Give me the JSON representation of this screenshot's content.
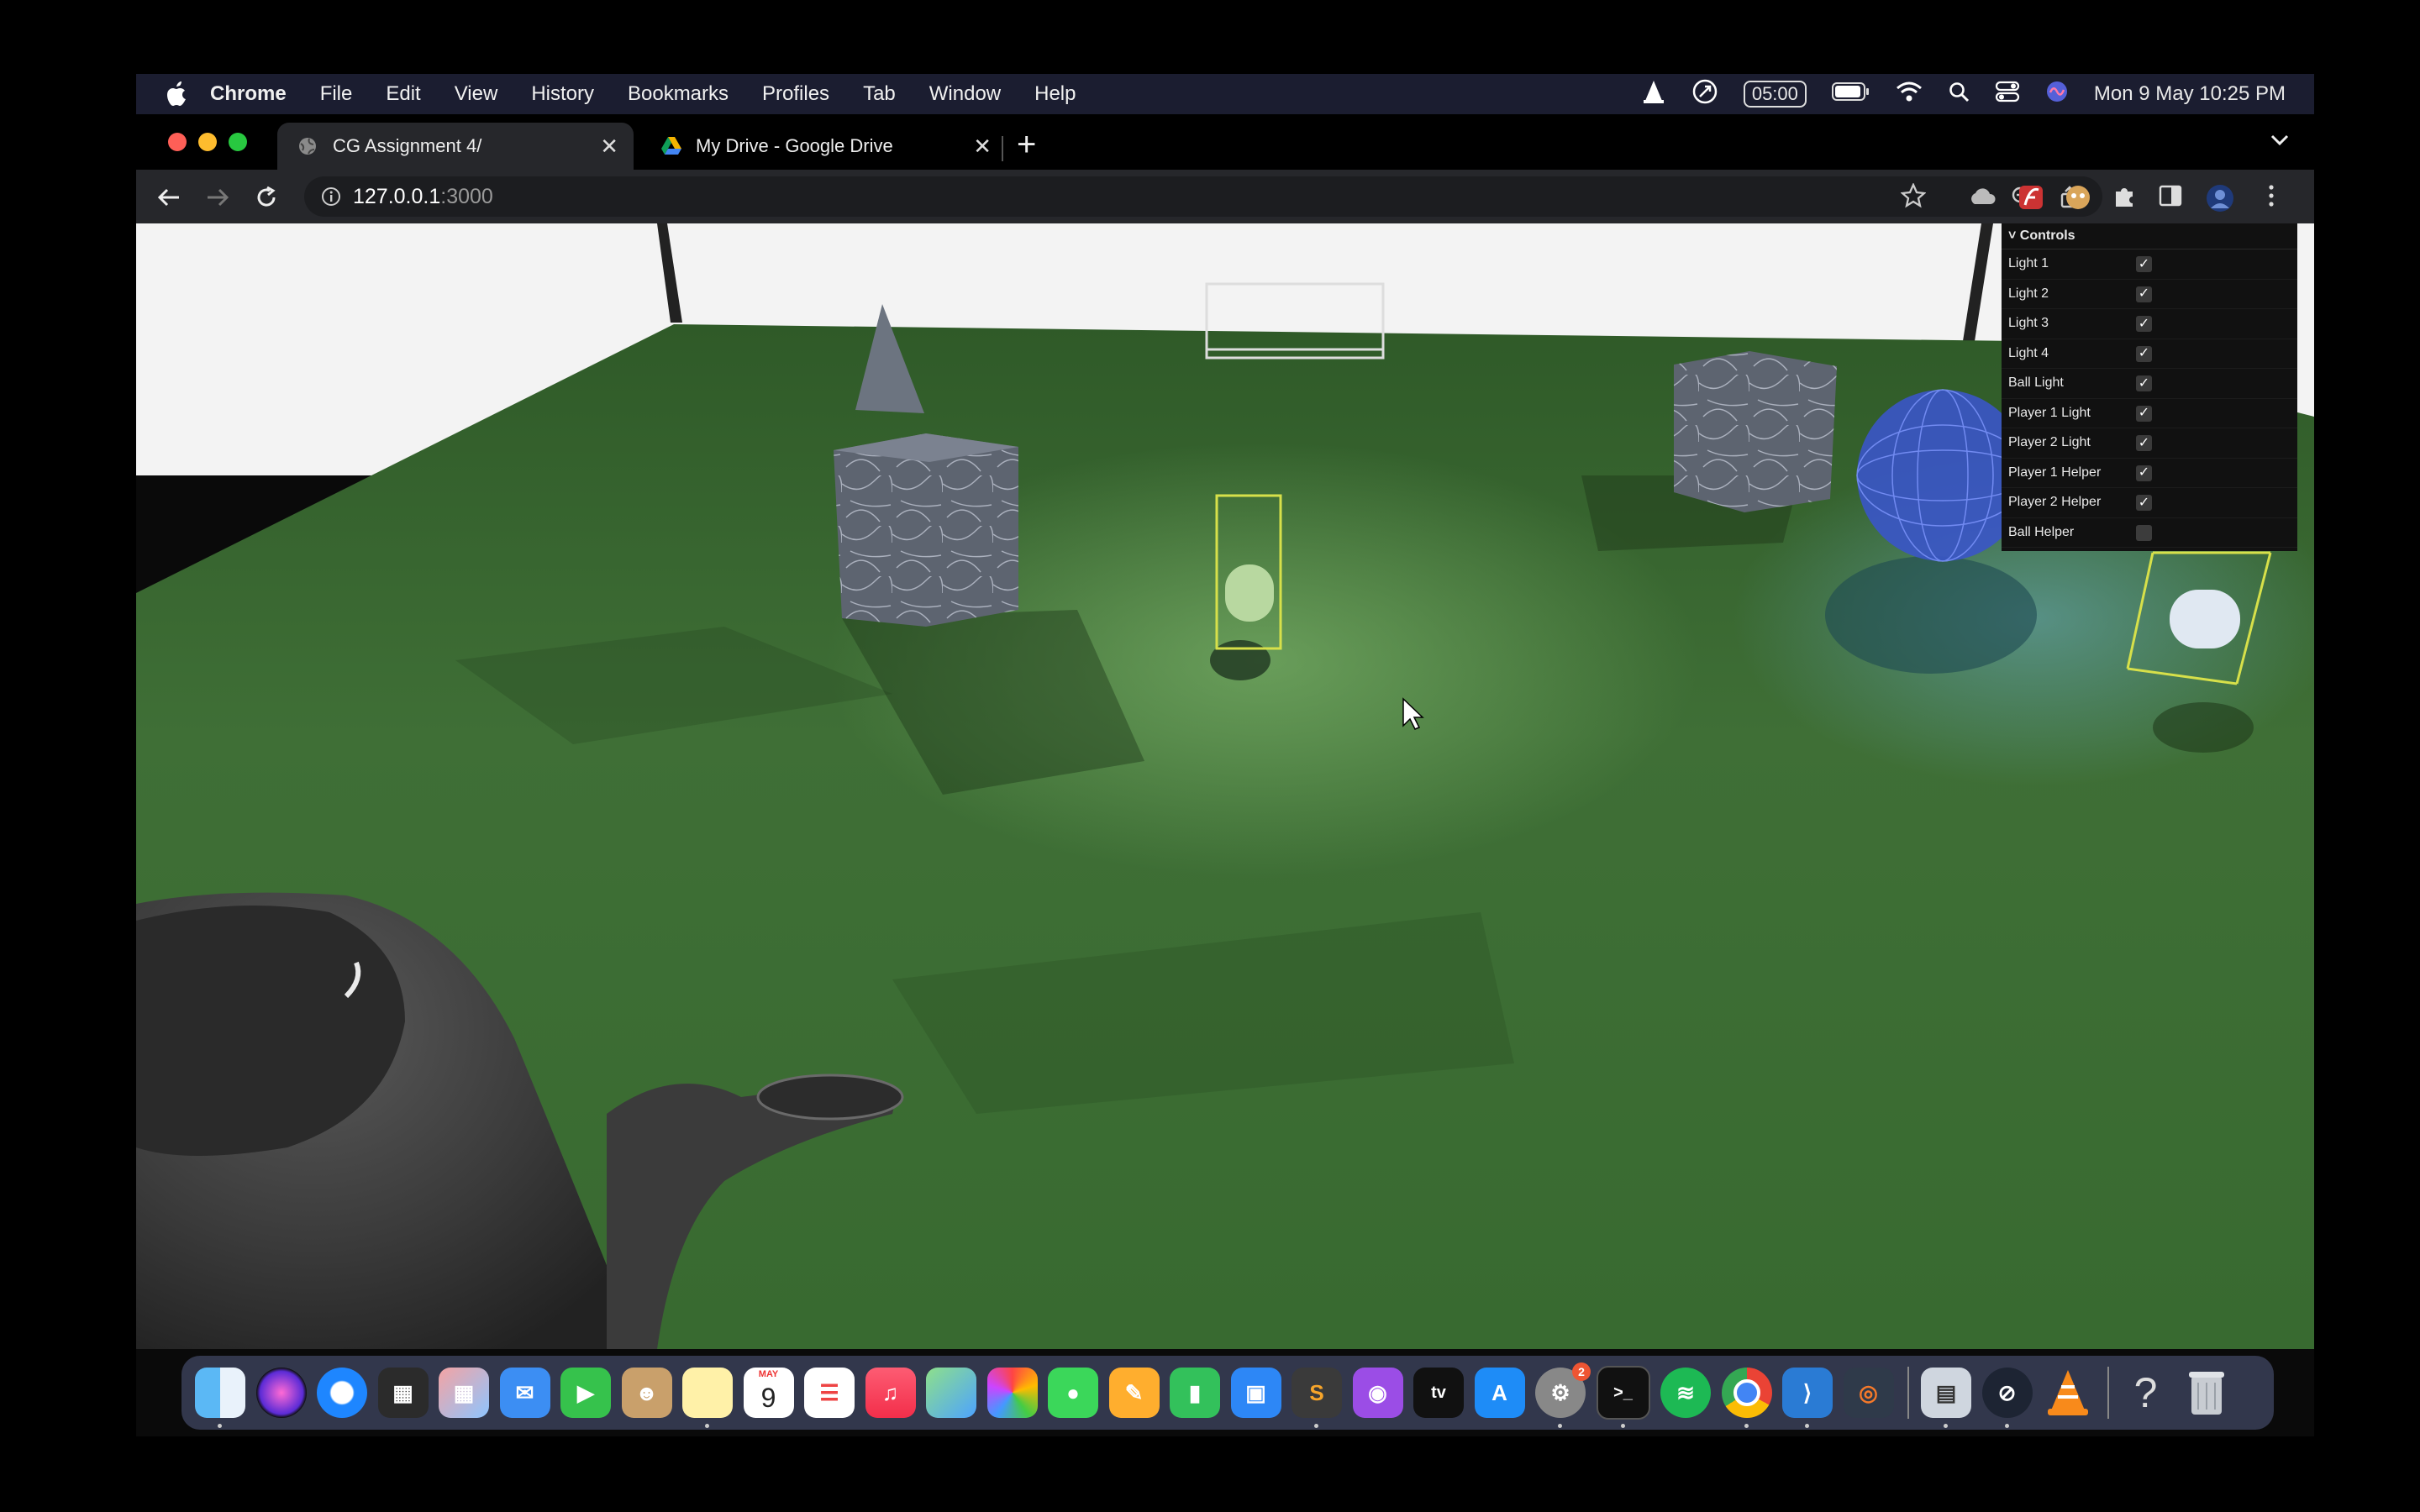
{
  "menubar": {
    "app_name": "Chrome",
    "items": [
      "File",
      "Edit",
      "View",
      "History",
      "Bookmarks",
      "Profiles",
      "Tab",
      "Window",
      "Help"
    ],
    "timer": "05:00",
    "datetime": "Mon 9 May  10:25 PM"
  },
  "tabs": [
    {
      "title": "CG Assignment 4/",
      "active": true
    },
    {
      "title": "My Drive - Google Drive",
      "active": false
    }
  ],
  "address": {
    "host": "127.0.0.1",
    "port": ":3000"
  },
  "gui": {
    "title": "Controls",
    "items": [
      {
        "label": "Light 1",
        "checked": true
      },
      {
        "label": "Light 2",
        "checked": true
      },
      {
        "label": "Light 3",
        "checked": true
      },
      {
        "label": "Light 4",
        "checked": true
      },
      {
        "label": "Ball Light",
        "checked": true
      },
      {
        "label": "Player 1 Light",
        "checked": true
      },
      {
        "label": "Player 2 Light",
        "checked": true
      },
      {
        "label": "Player 1 Helper",
        "checked": true
      },
      {
        "label": "Player 2 Helper",
        "checked": true
      },
      {
        "label": "Ball Helper",
        "checked": false
      }
    ]
  },
  "dock": {
    "calendar_month": "MAY",
    "calendar_day": "9",
    "settings_badge": "2",
    "tv_label": "tv"
  },
  "colors": {
    "grass": "#3f6f36",
    "menubar": "#1b1d30",
    "toolbar": "#26272b"
  }
}
